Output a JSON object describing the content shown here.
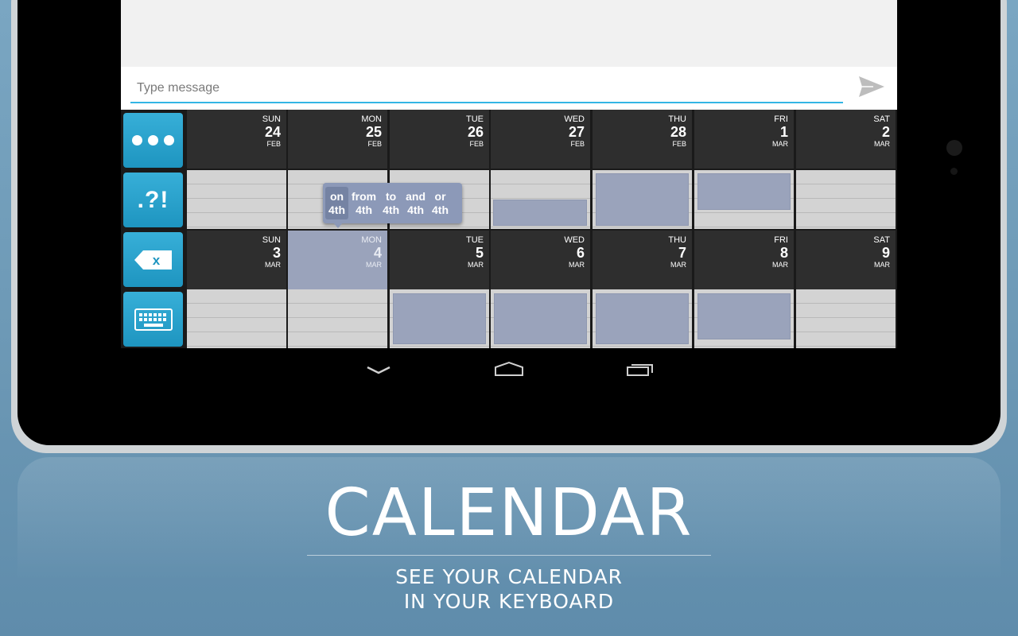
{
  "compose": {
    "placeholder": "Type message"
  },
  "side_buttons": [
    {
      "name": "more",
      "label": ""
    },
    {
      "name": "punctuation",
      "label": ".?!"
    },
    {
      "name": "delete",
      "label": "x"
    },
    {
      "name": "keyboard",
      "label": ""
    }
  ],
  "calendar": {
    "week1": [
      {
        "dow": "SUN",
        "num": "24",
        "mon": "FEB"
      },
      {
        "dow": "MON",
        "num": "25",
        "mon": "FEB"
      },
      {
        "dow": "TUE",
        "num": "26",
        "mon": "FEB"
      },
      {
        "dow": "WED",
        "num": "27",
        "mon": "FEB"
      },
      {
        "dow": "THU",
        "num": "28",
        "mon": "FEB"
      },
      {
        "dow": "FRI",
        "num": "1",
        "mon": "MAR"
      },
      {
        "dow": "SAT",
        "num": "2",
        "mon": "MAR"
      }
    ],
    "week2": [
      {
        "dow": "SUN",
        "num": "3",
        "mon": "MAR"
      },
      {
        "dow": "MON",
        "num": "4",
        "mon": "MAR"
      },
      {
        "dow": "TUE",
        "num": "5",
        "mon": "MAR"
      },
      {
        "dow": "WED",
        "num": "6",
        "mon": "MAR"
      },
      {
        "dow": "THU",
        "num": "7",
        "mon": "MAR"
      },
      {
        "dow": "FRI",
        "num": "8",
        "mon": "MAR"
      },
      {
        "dow": "SAT",
        "num": "9",
        "mon": "MAR"
      }
    ]
  },
  "suggestions": [
    {
      "word": "on",
      "date": "4th"
    },
    {
      "word": "from",
      "date": "4th"
    },
    {
      "word": "to",
      "date": "4th"
    },
    {
      "word": "and",
      "date": "4th"
    },
    {
      "word": "or",
      "date": "4th"
    }
  ],
  "promo": {
    "title": "CALENDAR",
    "subtitle_line1": "SEE YOUR CALENDAR",
    "subtitle_line2": "IN YOUR KEYBOARD"
  },
  "colors": {
    "accent": "#33b5e5",
    "side_button": "#1e95c0",
    "event": "#9aa3bb",
    "background": "#6f9ab6"
  }
}
